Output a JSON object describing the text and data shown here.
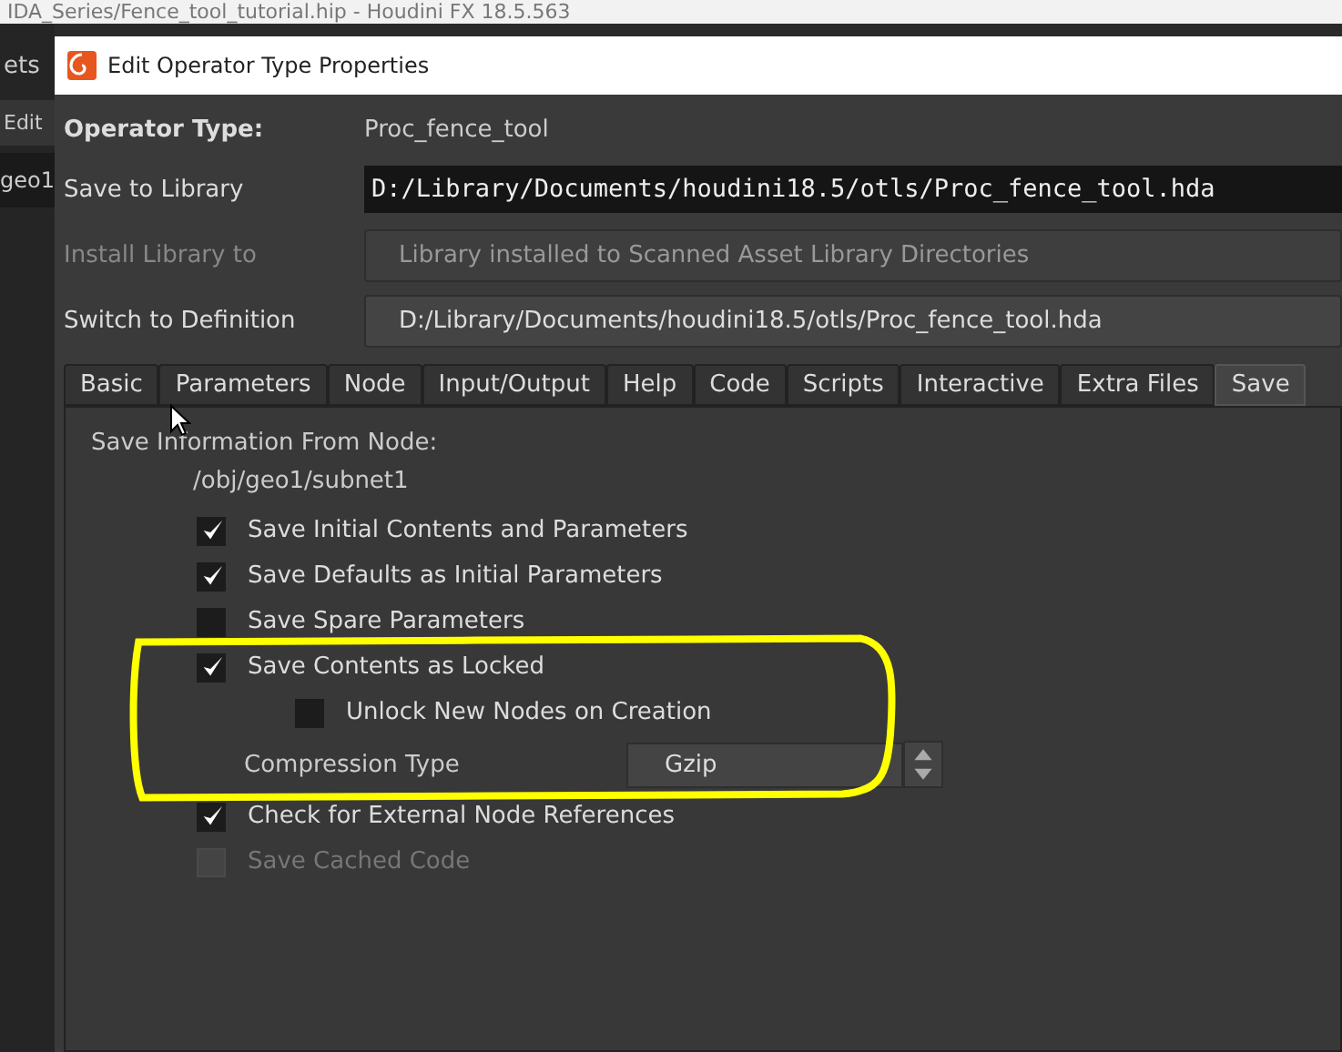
{
  "background": {
    "title": "IDA_Series/Fence_tool_tutorial.hip - Houdini FX 18.5.563",
    "menu_fragments": [
      "ets"
    ],
    "pane_tab": "Edit",
    "node_tab": "geo1"
  },
  "dialog": {
    "title": "Edit Operator Type Properties",
    "operator_type": {
      "label": "Operator Type:",
      "value": "Proc_fence_tool"
    },
    "fields": [
      {
        "label": "Save to Library",
        "value": "D:/Library/Documents/houdini18.5/otls/Proc_fence_tool.hda",
        "kind": "path",
        "disabled": false
      },
      {
        "label": "Install Library to",
        "value": "Library installed to Scanned Asset Library Directories",
        "kind": "menu",
        "disabled": true
      },
      {
        "label": "Switch to Definition",
        "value": "D:/Library/Documents/houdini18.5/otls/Proc_fence_tool.hda",
        "kind": "menu",
        "disabled": false
      }
    ],
    "tabs": [
      {
        "label": "Basic",
        "selected": false
      },
      {
        "label": "Parameters",
        "selected": false
      },
      {
        "label": "Node",
        "selected": false
      },
      {
        "label": "Input/Output",
        "selected": false
      },
      {
        "label": "Help",
        "selected": false
      },
      {
        "label": "Code",
        "selected": false
      },
      {
        "label": "Scripts",
        "selected": false
      },
      {
        "label": "Interactive",
        "selected": false
      },
      {
        "label": "Extra Files",
        "selected": false
      },
      {
        "label": "Save",
        "selected": true
      }
    ],
    "save": {
      "heading": "Save Information From Node:",
      "node_path": "/obj/geo1/subnet1",
      "options": [
        {
          "kind": "checkbox",
          "label": "Save Initial Contents and Parameters",
          "checked": true,
          "disabled": false,
          "indented": false
        },
        {
          "kind": "checkbox",
          "label": "Save Defaults as Initial Parameters",
          "checked": true,
          "disabled": false,
          "indented": false
        },
        {
          "kind": "checkbox",
          "label": "Save Spare Parameters",
          "checked": false,
          "disabled": false,
          "indented": false
        },
        {
          "kind": "checkbox",
          "label": "Save Contents as Locked",
          "checked": true,
          "disabled": false,
          "indented": false
        },
        {
          "kind": "checkbox",
          "label": "Unlock New Nodes on Creation",
          "checked": false,
          "disabled": false,
          "indented": true
        },
        {
          "kind": "dropdown",
          "label": "Compression Type",
          "value": "Gzip"
        },
        {
          "kind": "checkbox",
          "label": "Check for External Node References",
          "checked": true,
          "disabled": false,
          "indented": false
        },
        {
          "kind": "checkbox",
          "label": "Save Cached Code",
          "checked": false,
          "disabled": true,
          "indented": false
        }
      ]
    }
  }
}
